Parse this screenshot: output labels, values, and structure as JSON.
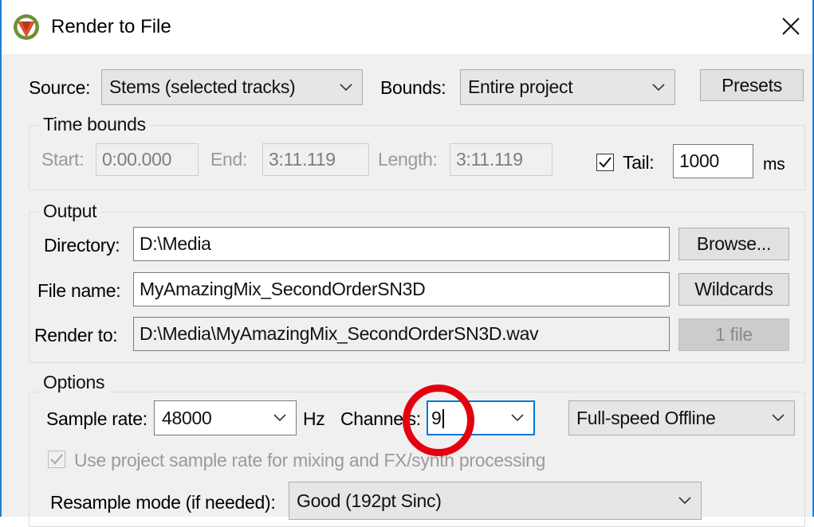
{
  "window": {
    "title": "Render to File"
  },
  "source": {
    "label": "Source:",
    "value": "Stems (selected tracks)"
  },
  "bounds": {
    "label": "Bounds:",
    "value": "Entire project"
  },
  "presets_label": "Presets",
  "time_bounds": {
    "title": "Time bounds",
    "start_label": "Start:",
    "start_value": "0:00.000",
    "end_label": "End:",
    "end_value": "3:11.119",
    "length_label": "Length:",
    "length_value": "3:11.119",
    "tail_label": "Tail:",
    "tail_checked": true,
    "tail_value": "1000",
    "tail_unit": "ms"
  },
  "output": {
    "title": "Output",
    "directory_label": "Directory:",
    "directory_value": "D:\\Media",
    "browse_label": "Browse...",
    "filename_label": "File name:",
    "filename_value": "MyAmazingMix_SecondOrderSN3D",
    "wildcards_label": "Wildcards",
    "renderto_label": "Render to:",
    "renderto_value": "D:\\Media\\MyAmazingMix_SecondOrderSN3D.wav",
    "files_label": "1 file"
  },
  "options": {
    "title": "Options",
    "samplerate_label": "Sample rate:",
    "samplerate_value": "48000",
    "hz_label": "Hz",
    "channels_label": "Channels:",
    "channels_value": "9",
    "mode_value": "Full-speed Offline",
    "use_project_rate_label": "Use project sample rate for mixing and FX/synth processing",
    "use_project_rate_checked": true,
    "resample_label": "Resample mode (if needed):",
    "resample_value": "Good (192pt Sinc)"
  },
  "colors": {
    "accent": "#0078d7",
    "annotation": "#e4000f"
  }
}
